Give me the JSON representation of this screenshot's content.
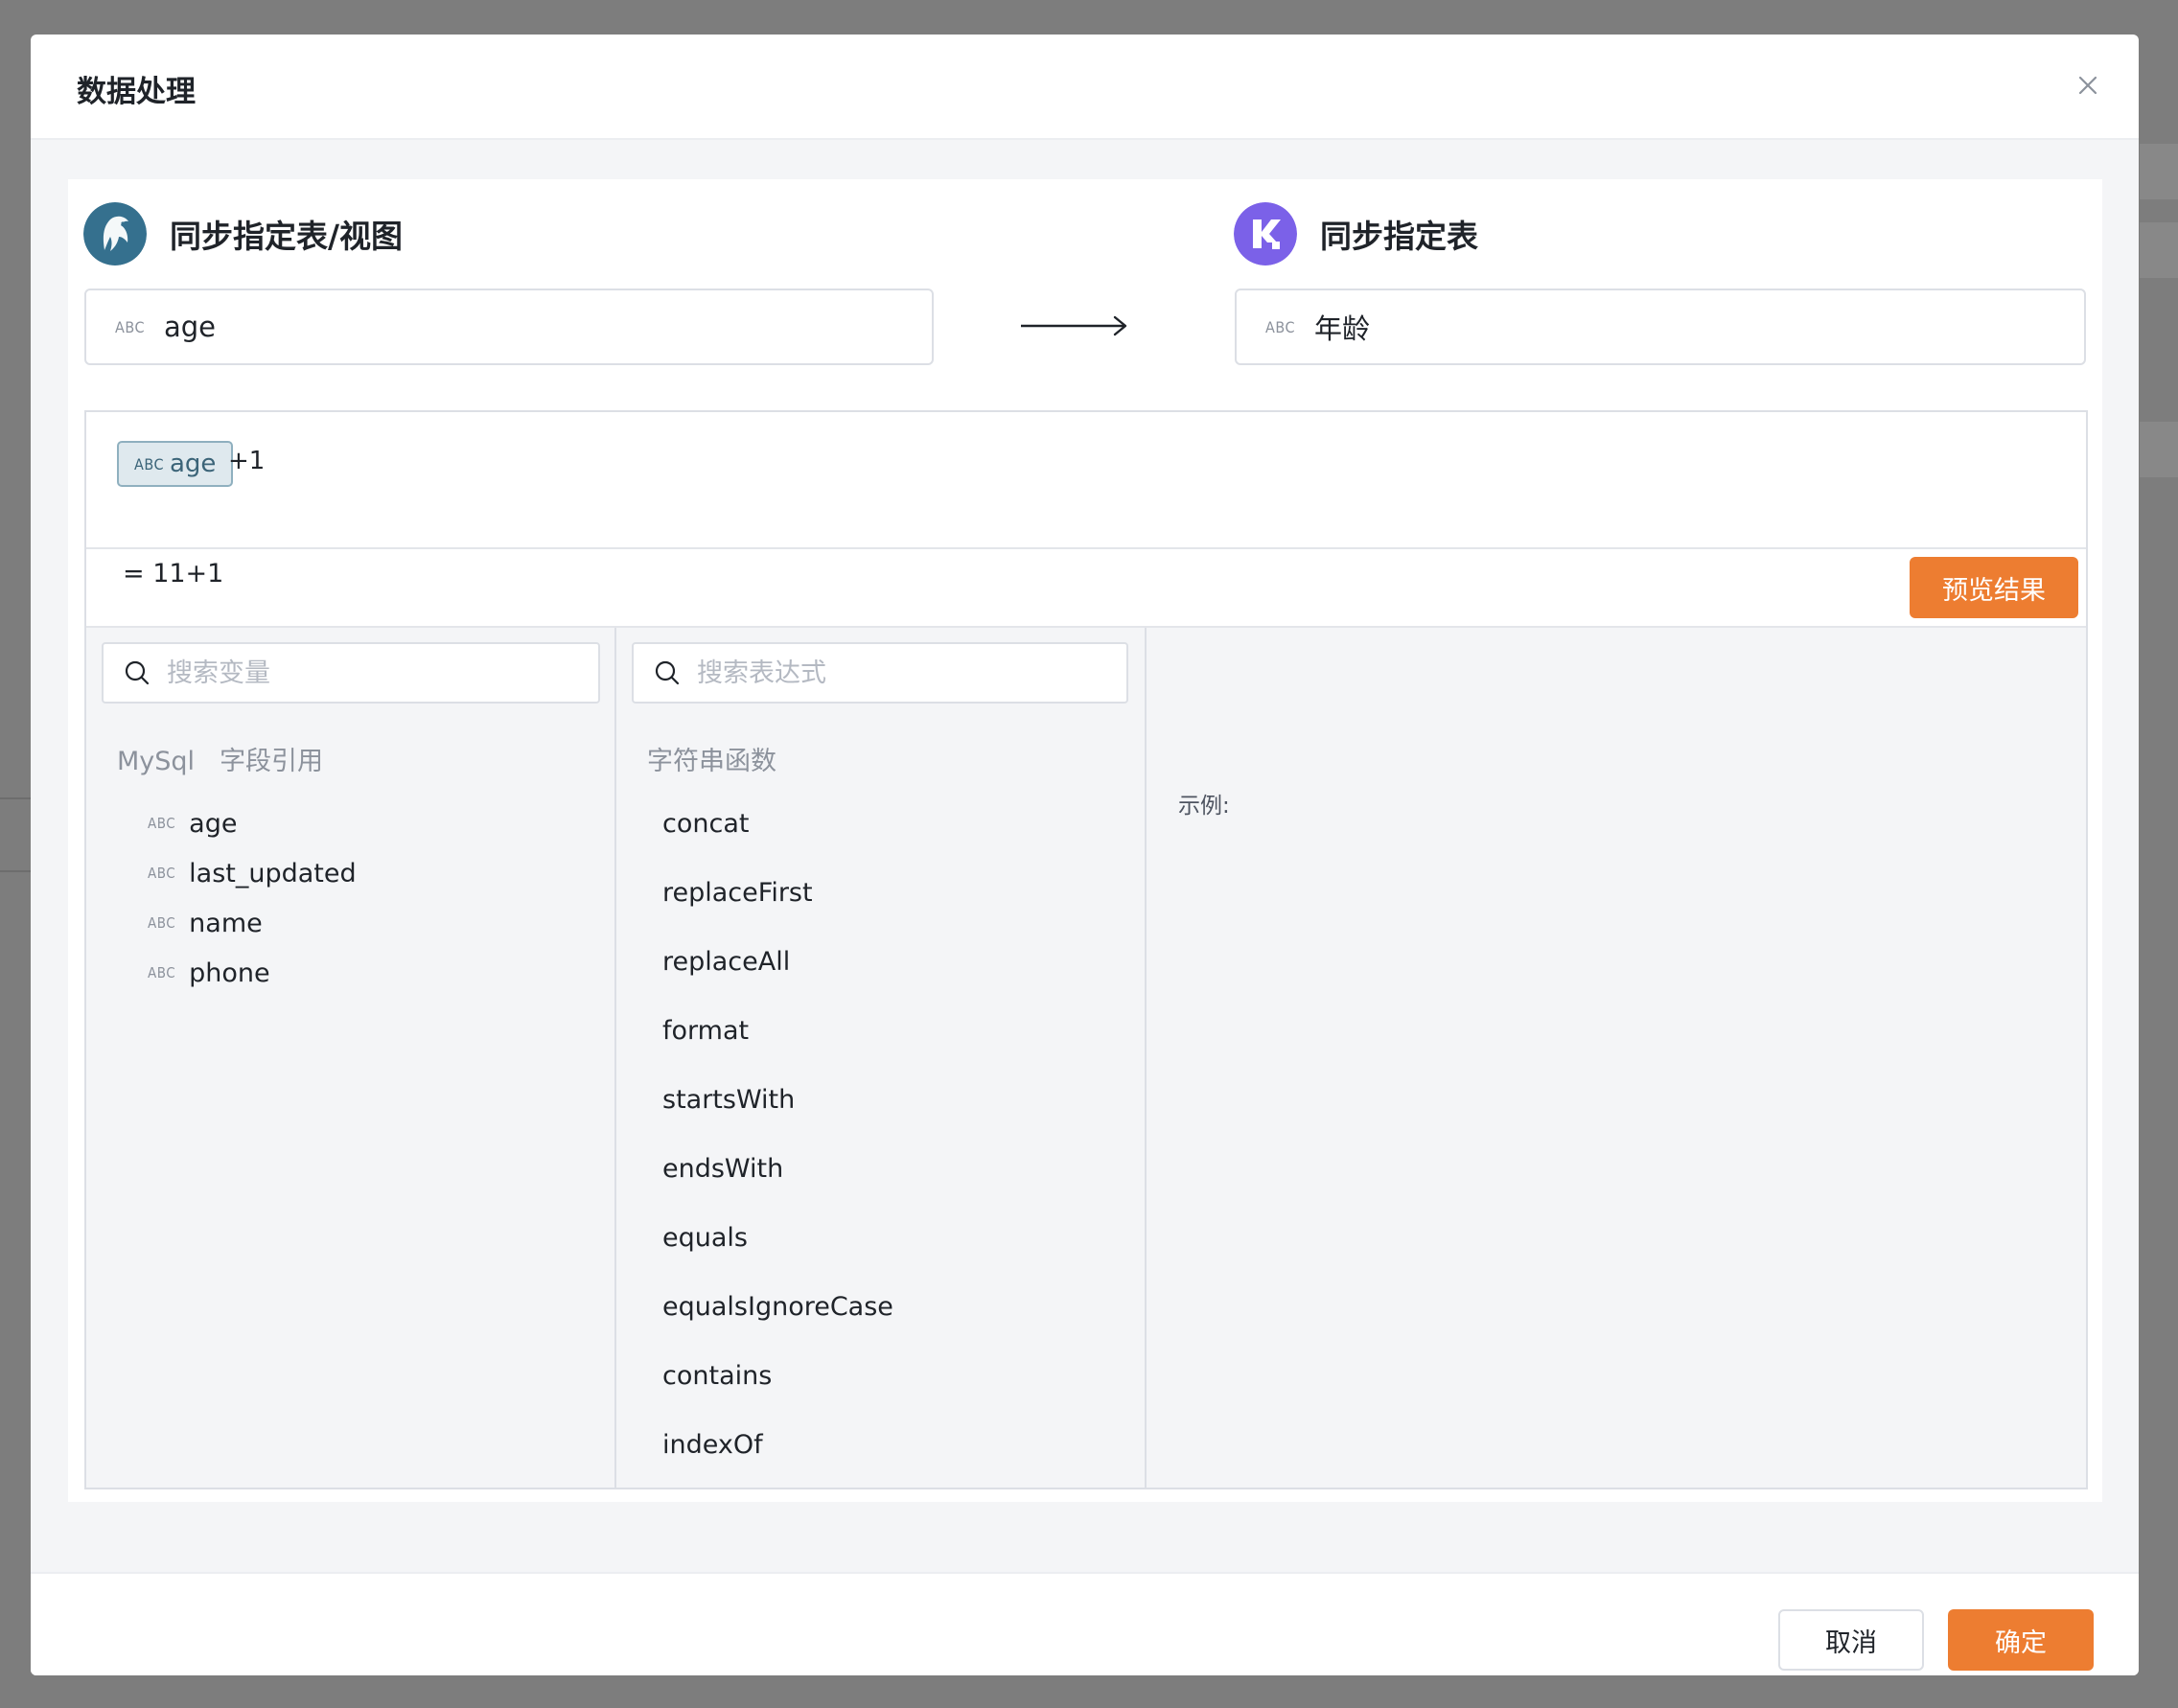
{
  "modal": {
    "title": "数据处理"
  },
  "source": {
    "header_label": "同步指定表/视图",
    "field_type": "ABC",
    "field_value": "age",
    "logo_icon": "mysql-dolphin-icon",
    "logo_color": "#35708e"
  },
  "target": {
    "header_label": "同步指定表",
    "field_type": "ABC",
    "field_value": "年龄",
    "logo_icon": "k-brand-icon",
    "logo_color": "#7b61e8"
  },
  "expression": {
    "chip_type": "ABC",
    "chip_field": "age",
    "suffix": "+1",
    "result": "=  11+1",
    "preview_label": "预览结果"
  },
  "variables": {
    "search_placeholder": "搜索变量",
    "source_name": "MySql",
    "group_label": "字段引用",
    "items": [
      {
        "type": "ABC",
        "name": "age"
      },
      {
        "type": "ABC",
        "name": "last_updated"
      },
      {
        "type": "ABC",
        "name": "name"
      },
      {
        "type": "ABC",
        "name": "phone"
      }
    ]
  },
  "functions": {
    "search_placeholder": "搜索表达式",
    "group_label": "字符串函数",
    "items": [
      "concat",
      "replaceFirst",
      "replaceAll",
      "format",
      "startsWith",
      "endsWith",
      "equals",
      "equalsIgnoreCase",
      "contains",
      "indexOf"
    ]
  },
  "example": {
    "label": "示例:"
  },
  "footer": {
    "cancel_label": "取消",
    "ok_label": "确定"
  },
  "colors": {
    "accent": "#ed7d31",
    "chip_bg": "#dfe9ee",
    "panel_bg": "#f4f5f7"
  }
}
